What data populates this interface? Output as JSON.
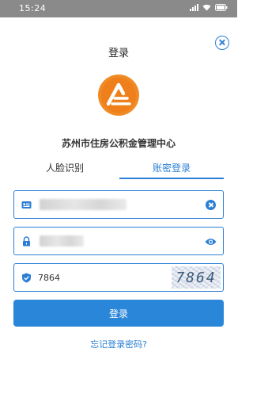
{
  "status_bar": {
    "time": "15:24"
  },
  "header": {
    "title": "登录"
  },
  "org_name": "苏州市住房公积金管理中心",
  "tabs": [
    {
      "label": "人脸识别",
      "active": false
    },
    {
      "label": "账密登录",
      "active": true
    }
  ],
  "form": {
    "username": {
      "value": ""
    },
    "password": {
      "value": ""
    },
    "captcha": {
      "value": "7864",
      "image_text": "7864"
    }
  },
  "login_button": {
    "label": "登录"
  },
  "forgot_link": {
    "label": "忘记登录密码?"
  },
  "colors": {
    "accent": "#2a7fd4",
    "button": "#2a86d9",
    "logo_orange": "#f08a24",
    "status_bar": "#8a8a8a"
  },
  "icons": {
    "close": "close-icon",
    "user": "id-card-icon",
    "password": "lock-icon",
    "captcha": "shield-check-icon",
    "clear": "clear-icon",
    "visibility": "eye-icon"
  }
}
